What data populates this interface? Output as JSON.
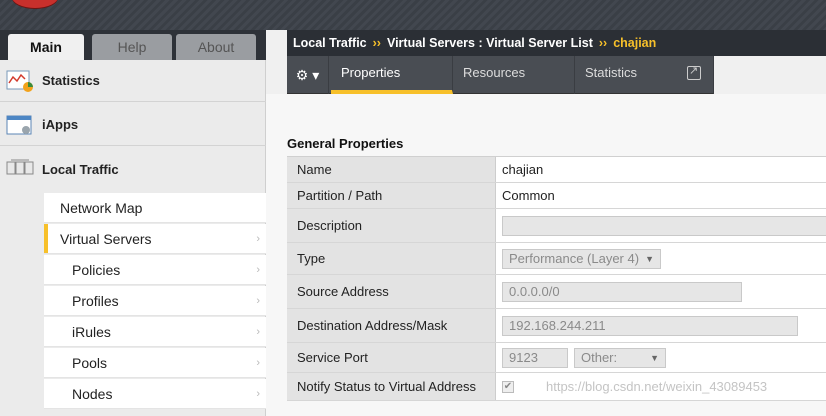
{
  "left_tabs": [
    "Main",
    "Help",
    "About"
  ],
  "sidebar": {
    "sections": [
      {
        "label": "Statistics",
        "icon": "statistics-chart-icon"
      },
      {
        "label": "iApps",
        "icon": "iapps-window-icon"
      },
      {
        "label": "Local Traffic",
        "icon": "local-traffic-icon"
      }
    ],
    "items": [
      {
        "label": "Network Map"
      },
      {
        "label": "Virtual Servers"
      },
      {
        "label": "Policies"
      },
      {
        "label": "Profiles"
      },
      {
        "label": "iRules"
      },
      {
        "label": "Pools"
      },
      {
        "label": "Nodes"
      }
    ]
  },
  "breadcrumb": {
    "part1": "Local Traffic",
    "sep": "››",
    "part2": "Virtual Servers : Virtual Server List",
    "current": "chajian"
  },
  "toolbar": {
    "gear": "⚙ ▾",
    "tabs": [
      "Properties",
      "Resources",
      "Statistics"
    ],
    "active_tab": "Properties"
  },
  "general": {
    "title": "General Properties",
    "rows": {
      "name": {
        "label": "Name",
        "value": "chajian"
      },
      "partition": {
        "label": "Partition / Path",
        "value": "Common"
      },
      "description": {
        "label": "Description",
        "value": ""
      },
      "type": {
        "label": "Type",
        "value": "Performance (Layer 4)"
      },
      "source": {
        "label": "Source Address",
        "value": "0.0.0.0/0"
      },
      "dest": {
        "label": "Destination Address/Mask",
        "value": "192.168.244.211"
      },
      "port": {
        "label": "Service Port",
        "value": "9123",
        "option": "Other:"
      },
      "notify": {
        "label": "Notify Status to Virtual Address",
        "checked": true
      }
    }
  },
  "watermark": "https://blog.csdn.net/weixin_43089453",
  "colors": {
    "accent": "#f7c02a",
    "header_dark": "#2b2f35"
  }
}
